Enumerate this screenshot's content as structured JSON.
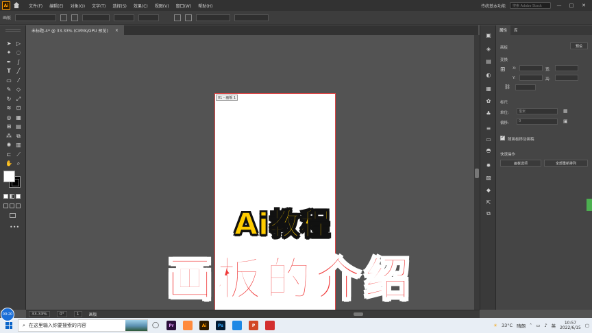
{
  "menubar": {
    "logo": "Ai",
    "items": [
      "文件(F)",
      "编辑(E)",
      "对象(O)",
      "文字(T)",
      "选择(S)",
      "效果(C)",
      "视图(V)",
      "窗口(W)",
      "帮助(H)"
    ],
    "workspace": "传统基本功能",
    "search_placeholder": "搜索 Adobe Stock",
    "win_buttons": [
      "—",
      "□",
      "✕"
    ]
  },
  "controlbar": {
    "left_label": "画板"
  },
  "document": {
    "tab_title": "未标题-4* @ 33.33% (CMYK/GPU 预览)",
    "tab_close": "×"
  },
  "artboard": {
    "label": "01 - 画板 1"
  },
  "statusbar": {
    "zoom": "33.33%",
    "angle": "0°",
    "page": "1",
    "mode": "画板"
  },
  "panel": {
    "tabs": [
      "属性",
      "库"
    ],
    "section_artboard": "画板",
    "preset_button": "预设",
    "section_transform": "变换",
    "x_label": "X:",
    "y_label": "Y:",
    "w_label": "宽:",
    "h_label": "高:",
    "section_rulers": "标尺",
    "unit_label": "单位:",
    "unit_value": "毫米",
    "offset_label": "偏移:",
    "offset_value": "0",
    "move_with_art": "随画板移动画稿",
    "quick_actions": "快速操作",
    "btn_artboard_options": "画板选项",
    "btn_rearrange": "全部重新排列"
  },
  "overlay": {
    "line1": "Ai教程",
    "line2": "画板的介绍"
  },
  "taskbar": {
    "search_placeholder": "在这里输入你要搜索的内容",
    "apps": [
      {
        "label": "Pr",
        "color": "#2a0f3a",
        "fg": "#e59bff"
      },
      {
        "label": "",
        "color": "#ff8a3d",
        "fg": "#fff"
      },
      {
        "label": "Ai",
        "color": "#2d1a00",
        "fg": "#ff9a00"
      },
      {
        "label": "Ps",
        "color": "#001a33",
        "fg": "#31a8ff"
      },
      {
        "label": "",
        "color": "#1e88e5",
        "fg": "#fff"
      },
      {
        "label": "P",
        "color": "#d24726",
        "fg": "#fff"
      },
      {
        "label": "",
        "color": "#d32f2f",
        "fg": "#fff"
      }
    ],
    "temperature": "33°C",
    "weather": "晴朗",
    "ime": "英",
    "time": "10:57",
    "date": "2022/6/15"
  },
  "avatar": {
    "label": "00:20"
  }
}
